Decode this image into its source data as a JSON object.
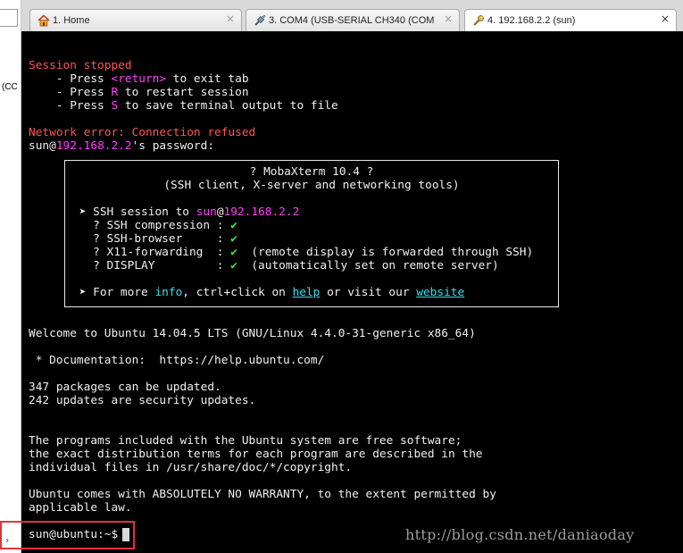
{
  "left_panel": {
    "clipped_text": "(CC"
  },
  "tabs": [
    {
      "label": "1. Home",
      "close": "×",
      "icon": "home-icon",
      "active": false
    },
    {
      "label": "3. COM4  (USB-SERIAL CH340 (COM",
      "close": "×",
      "icon": "serial-plug-icon",
      "active": false
    },
    {
      "label": "4. 192.168.2.2 (sun)",
      "close": "×",
      "icon": "ssh-wrench-icon",
      "active": true
    }
  ],
  "terminal": {
    "session_stopped": "Session stopped",
    "hint1_pre": "    - Press ",
    "hint1_key": "<return>",
    "hint1_post": " to exit tab",
    "hint2_pre": "    - Press ",
    "hint2_key": "R",
    "hint2_post": " to restart session",
    "hint3_pre": "    - Press ",
    "hint3_key": "S",
    "hint3_post": " to save terminal output to file",
    "network_error": "Network error: Connection refused",
    "pw_user": "sun",
    "pw_at": "@",
    "pw_host": "192.168.2.2",
    "pw_rest": "'s password:",
    "box": {
      "title": "? MobaXterm 10.4 ?",
      "subtitle": "(SSH client, X-server and networking tools)",
      "ssh_prefix": " ➤ SSH session to ",
      "ssh_user": "sun",
      "ssh_at": "@",
      "ssh_host": "192.168.2.2",
      "rows": [
        {
          "label": "   ? SSH compression : ",
          "mark": "✔",
          "note": ""
        },
        {
          "label": "   ? SSH-browser     : ",
          "mark": "✔",
          "note": ""
        },
        {
          "label": "   ? X11-forwarding  : ",
          "mark": "✔",
          "note": "  (remote display is forwarded through SSH)"
        },
        {
          "label": "   ? DISPLAY         : ",
          "mark": "✔",
          "note": "  (automatically set on remote server)"
        }
      ],
      "more_pre": " ➤ For more ",
      "more_info": "info",
      "more_mid": ", ctrl+click on ",
      "more_help": "help",
      "more_or": " or visit our ",
      "more_site": "website"
    },
    "welcome": "Welcome to Ubuntu 14.04.5 LTS (GNU/Linux 4.4.0-31-generic x86_64)",
    "docs": " * Documentation:  https://help.ubuntu.com/",
    "packages": "347 packages can be updated.",
    "security": "242 updates are security updates.",
    "programs1": "The programs included with the Ubuntu system are free software;",
    "programs2": "the exact distribution terms for each program are described in the",
    "programs3": "individual files in /usr/share/doc/*/copyright.",
    "warranty1": "Ubuntu comes with ABSOLUTELY NO WARRANTY, to the extent permitted by",
    "warranty2": "applicable law.",
    "prompt": "sun@ubuntu:~$"
  },
  "watermark": "http://blog.csdn.net/daniaoday"
}
